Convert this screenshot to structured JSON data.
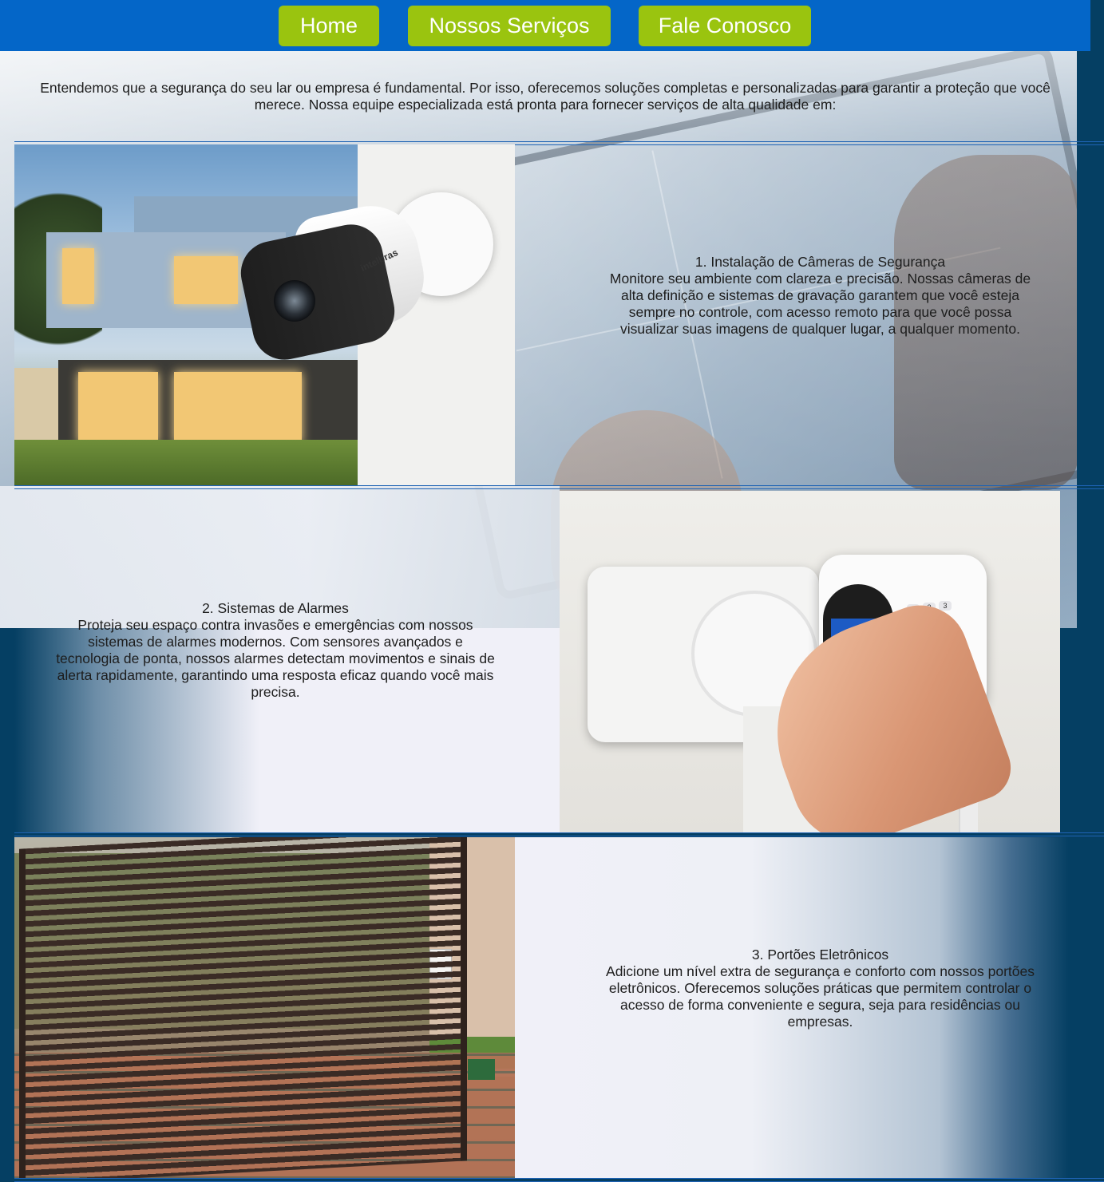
{
  "nav": {
    "home": "Home",
    "servicos": "Nossos Serviços",
    "contato": "Fale Conosco"
  },
  "intro": "Entendemos que a segurança do seu lar ou empresa é fundamental. Por isso, oferecemos soluções completas e personalizadas para garantir a proteção que você merece. Nossa equipe especializada está pronta para fornecer serviços de alta qualidade em:",
  "services": [
    {
      "title": "1. Instalação de Câmeras de Segurança",
      "description": "Monitore seu ambiente com clareza e precisão. Nossas câmeras de alta definição e sistemas de gravação garantem que você esteja sempre no controle, com acesso remoto para que você possa visualizar suas imagens de qualquer lugar, a qualquer momento."
    },
    {
      "title": "2. Sistemas de Alarmes",
      "description": "Proteja seu espaço contra invasões e emergências com nossos sistemas de alarmes modernos. Com sensores avançados e tecnologia de ponta, nossos alarmes detectam movimentos e sinais de alerta rapidamente, garantindo uma resposta eficaz quando você mais precisa."
    },
    {
      "title": "3. Portões Eletrônicos",
      "description": "Adicione um nível extra de segurança e conforto com nossos portões eletrônicos. Oferecemos soluções práticas que permitem controlar o acesso de forma conveniente e segura, seja para residências ou empresas."
    }
  ],
  "images": {
    "camera_brand": "intelbras"
  },
  "colors": {
    "nav_bg": "#0466c8",
    "nav_button": "#9ac40f",
    "page_bg": "#053f63",
    "separator": "#1e63b4"
  }
}
